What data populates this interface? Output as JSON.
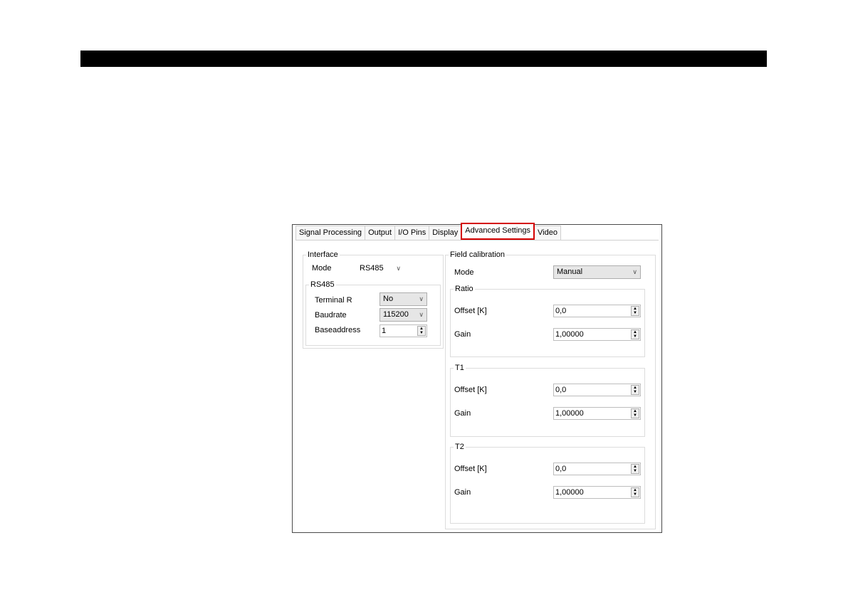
{
  "tabs": [
    {
      "label": "Signal Processing",
      "active": false
    },
    {
      "label": "Output",
      "active": false
    },
    {
      "label": "I/O Pins",
      "active": false
    },
    {
      "label": "Display",
      "active": false
    },
    {
      "label": "Advanced Settings",
      "active": true
    },
    {
      "label": "Video",
      "active": false
    }
  ],
  "interface": {
    "title": "Interface",
    "mode_label": "Mode",
    "mode_value": "RS485",
    "rs485": {
      "title": "RS485",
      "terminal_label": "Terminal R",
      "terminal_value": "No",
      "baudrate_label": "Baudrate",
      "baudrate_value": "115200",
      "baseaddress_label": "Baseaddress",
      "baseaddress_value": "1"
    }
  },
  "field_calibration": {
    "title": "Field calibration",
    "mode_label": "Mode",
    "mode_value": "Manual",
    "ratio": {
      "title": "Ratio",
      "offset_label": "Offset [K]",
      "offset_value": "0,0",
      "gain_label": "Gain",
      "gain_value": "1,00000"
    },
    "t1": {
      "title": "T1",
      "offset_label": "Offset [K]",
      "offset_value": "0,0",
      "gain_label": "Gain",
      "gain_value": "1,00000"
    },
    "t2": {
      "title": "T2",
      "offset_label": "Offset [K]",
      "offset_value": "0,0",
      "gain_label": "Gain",
      "gain_value": "1,00000"
    }
  },
  "colors": {
    "highlight": "#d40000",
    "header_bar": "#000000"
  }
}
